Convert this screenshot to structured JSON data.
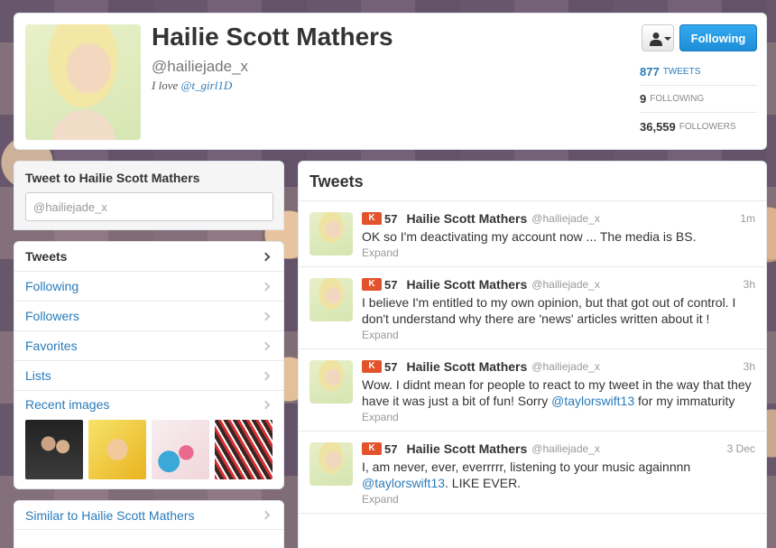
{
  "profile": {
    "name": "Hailie Scott Mathers",
    "handle": "@hailiejade_x",
    "bio_prefix": "I love ",
    "bio_link": "@t_girl1D",
    "following_button": "Following",
    "stats": [
      {
        "value": "877",
        "label": "TWEETS"
      },
      {
        "value": "9",
        "label": "FOLLOWING"
      },
      {
        "value": "36,559",
        "label": "FOLLOWERS"
      }
    ]
  },
  "compose": {
    "title": "Tweet to Hailie Scott Mathers",
    "value": "@hailiejade_x"
  },
  "nav": {
    "items": [
      {
        "label": "Tweets"
      },
      {
        "label": "Following"
      },
      {
        "label": "Followers"
      },
      {
        "label": "Favorites"
      },
      {
        "label": "Lists"
      },
      {
        "label": "Recent images"
      }
    ],
    "similar": "Similar to Hailie Scott Mathers"
  },
  "tweets": {
    "title": "Tweets",
    "expand_label": "Expand",
    "items": [
      {
        "klout": "57",
        "name": "Hailie Scott Mathers",
        "handle": "@hailiejade_x",
        "time": "1m",
        "text": "OK so I'm deactivating my account now ... The media is BS."
      },
      {
        "klout": "57",
        "name": "Hailie Scott Mathers",
        "handle": "@hailiejade_x",
        "time": "3h",
        "text": "I believe I'm entitled to my own opinion, but that got out of control. I don't understand why there are 'news' articles written about it !"
      },
      {
        "klout": "57",
        "name": "Hailie Scott Mathers",
        "handle": "@hailiejade_x",
        "time": "3h",
        "text_before": "Wow. I didnt mean for people to react to my tweet in the way that they have it was just a bit of fun! Sorry ",
        "mention": "@taylorswift13",
        "text_after": " for my immaturity"
      },
      {
        "klout": "57",
        "name": "Hailie Scott Mathers",
        "handle": "@hailiejade_x",
        "time": "3 Dec",
        "text_before": "I, am never, ever, everrrrr, listening to your music againnnn ",
        "mention": "@taylorswift13",
        "text_after": ". LIKE EVER."
      }
    ]
  },
  "colors": {
    "link": "#2b7bb9",
    "follow_button": "#1d8ed8",
    "klout": "#e2532c"
  }
}
